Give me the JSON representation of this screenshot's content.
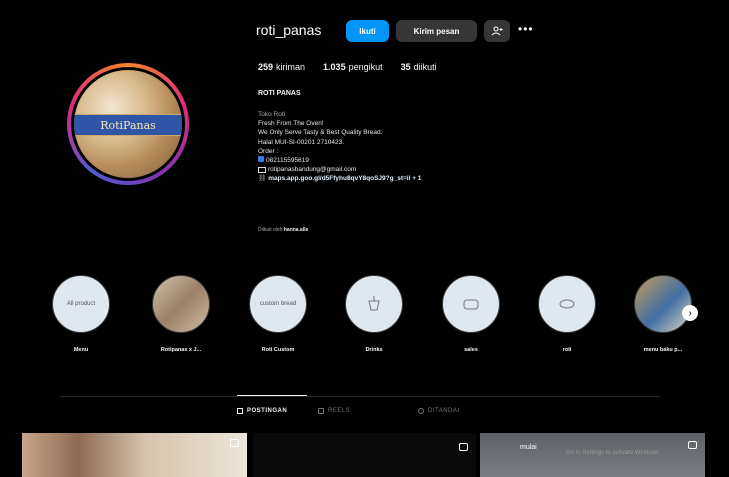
{
  "profile": {
    "username": "roti_panas",
    "follow_label": "Ikuti",
    "message_label": "Kirim pesan",
    "add_user_icon": "add-user-icon",
    "more_label": "•••",
    "avatar_text": "RotiPanas",
    "stats": {
      "posts_count": "259",
      "posts_label": "kiriman",
      "followers_count": "1.035",
      "followers_label": "pengikut",
      "following_count": "35",
      "following_label": "diikuti"
    },
    "full_name": "ROTI PANAS",
    "category": "Toko Roti",
    "bio_lines": [
      "Fresh From The Oven!",
      "We Only Serve Tasty & Best Quality Bread.",
      "Halal MUI-SI-00201 2710423.",
      "Order :"
    ],
    "phone": "082115595619",
    "email": "rotipanasbandung@gmail.com",
    "link": "maps.app.goo.gl/d5Ffyhu8qvY8qoSJ9?g_st=il + 1",
    "followed_by_prefix": "Diikuti oleh",
    "followed_by_user": "hanna.alle"
  },
  "highlights": [
    {
      "label": "Menu",
      "circle_text": "All product"
    },
    {
      "label": "Rotipanas x J...",
      "circle_text": ""
    },
    {
      "label": "Roti Custom",
      "circle_text": "custom bread"
    },
    {
      "label": "Drinks",
      "circle_text": ""
    },
    {
      "label": "sales",
      "circle_text": ""
    },
    {
      "label": "roti",
      "circle_text": ""
    },
    {
      "label": "menu baku p...",
      "circle_text": ""
    }
  ],
  "tabs": [
    {
      "label": "POSTINGAN",
      "active": true
    },
    {
      "label": "REELS",
      "active": false
    },
    {
      "label": "DITANDAI",
      "active": false
    }
  ],
  "post_overlay_text": "mulai",
  "watermark_text": "Go to Settings to activate Windows",
  "colors": {
    "accent": "#0095f6",
    "background": "#000000",
    "secondary_button": "#363636"
  }
}
